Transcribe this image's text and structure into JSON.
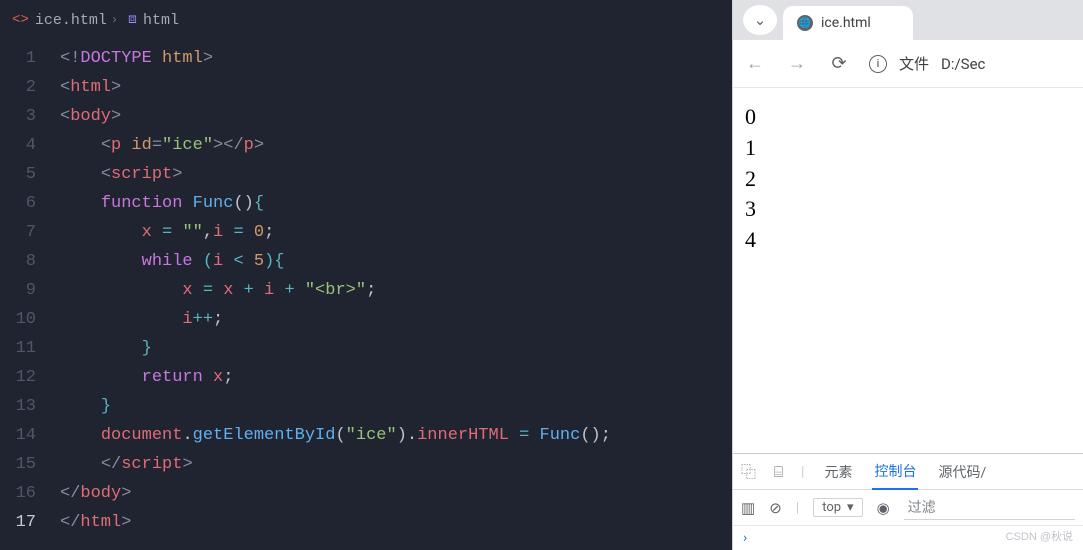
{
  "breadcrumb": {
    "file": "ice.html",
    "symbol": "html"
  },
  "editor": {
    "lines": [
      1,
      2,
      3,
      4,
      5,
      6,
      7,
      8,
      9,
      10,
      11,
      12,
      13,
      14,
      15,
      16,
      17
    ],
    "activeLine": 17
  },
  "code": {
    "l1_doctype": "DOCTYPE",
    "l1_html": "html",
    "l2_tag": "html",
    "l3_tag": "body",
    "l4_tag": "p",
    "l4_attr": "id",
    "l4_val": "\"ice\"",
    "l5_tag": "script",
    "l6_kw": "function",
    "l6_fn": "Func",
    "l7_x": "x",
    "l7_eq": "=",
    "l7_empty": "\"\"",
    "l7_i": "i",
    "l7_zero": "0",
    "l8_kw": "while",
    "l8_i": "i",
    "l8_lt": "<",
    "l8_five": "5",
    "l9_x": "x",
    "l9_i": "i",
    "l9_br": "\"<br>\"",
    "l10_i": "i",
    "l10_pp": "++",
    "l12_kw": "return",
    "l12_x": "x",
    "l14_doc": "document",
    "l14_get": "getElementById",
    "l14_ice": "\"ice\"",
    "l14_inner": "innerHTML",
    "l14_fn": "Func",
    "l15_tag": "script",
    "l16_tag": "body",
    "l17_tag": "html"
  },
  "browser": {
    "tabTitle": "ice.html",
    "addrLabel": "文件",
    "addrPath": "D:/Sec",
    "output": [
      "0",
      "1",
      "2",
      "3",
      "4"
    ]
  },
  "devtools": {
    "tabs": {
      "elements": "元素",
      "console": "控制台",
      "sources": "源代码/"
    },
    "top": "top",
    "filter": "过滤",
    "prompt": "›"
  },
  "watermark": "CSDN @秋说"
}
